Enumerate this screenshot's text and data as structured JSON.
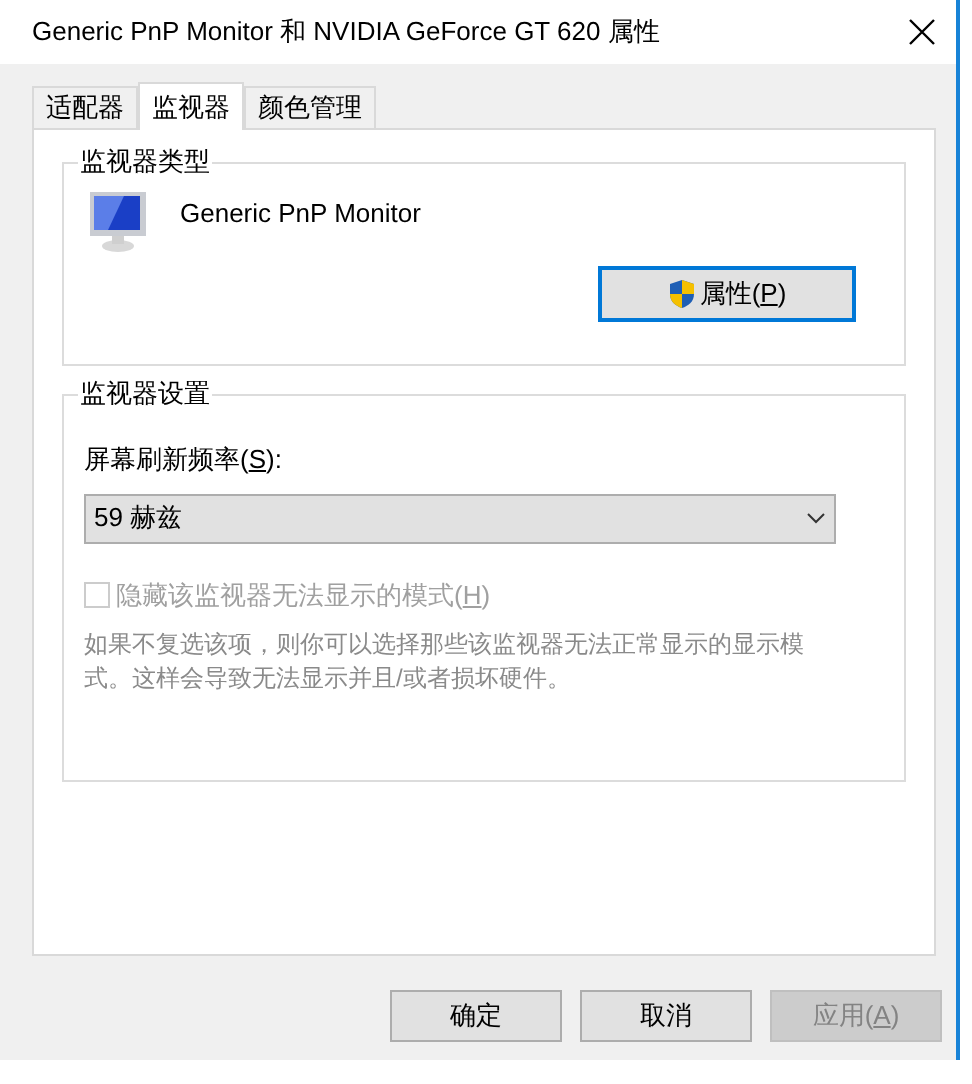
{
  "window": {
    "title": "Generic PnP Monitor 和 NVIDIA GeForce GT 620 属性"
  },
  "tabs": [
    {
      "label": "适配器",
      "selected": false
    },
    {
      "label": "监视器",
      "selected": true
    },
    {
      "label": "颜色管理",
      "selected": false
    }
  ],
  "monitor_type": {
    "title": "监视器类型",
    "name": "Generic PnP Monitor",
    "button_parts": [
      "属性(",
      "P",
      ")"
    ]
  },
  "monitor_settings": {
    "title": "监视器设置",
    "refresh_label_parts": [
      "屏幕刷新频率(",
      "S",
      "):"
    ],
    "refresh_value": "59 赫兹",
    "hide_modes": {
      "label_parts": [
        "隐藏该监视器无法显示的模式(",
        "H",
        ")"
      ],
      "checked": false,
      "disabled": true
    },
    "description": "如果不复选该项，则你可以选择那些该监视器无法正常显示的显示模式。这样会导致无法显示并且/或者损坏硬件。"
  },
  "buttons": [
    {
      "parts": [
        "确定"
      ],
      "disabled": false
    },
    {
      "parts": [
        "取消"
      ],
      "disabled": false
    },
    {
      "parts": [
        "应用(",
        "A",
        ")"
      ],
      "disabled": true
    }
  ]
}
